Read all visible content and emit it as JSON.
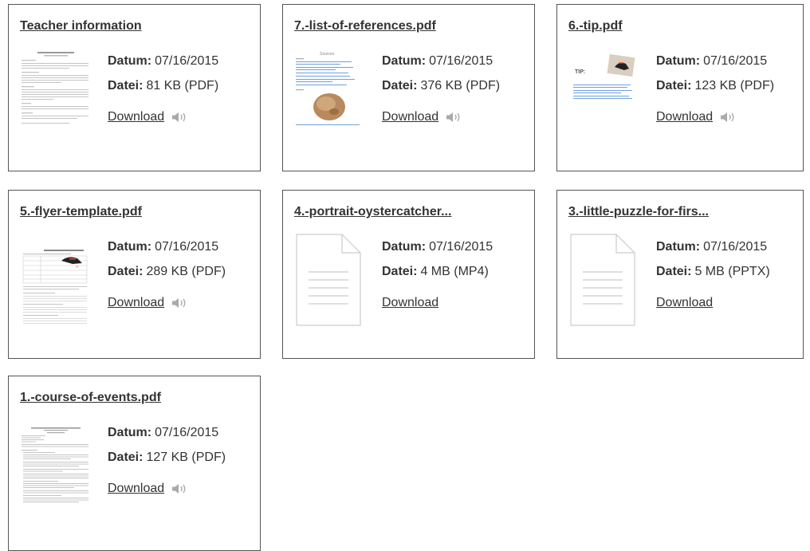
{
  "cards": [
    {
      "title": "Teacher information",
      "date_label": "Datum:",
      "date": "07/16/2015",
      "size_label": "Datei:",
      "size": "81 KB (PDF)",
      "download": "Download"
    },
    {
      "title": "7.-list-of-references.pdf",
      "date_label": "Datum:",
      "date": "07/16/2015",
      "size_label": "Datei:",
      "size": "376 KB (PDF)",
      "download": "Download",
      "thumb_heading": "Sources"
    },
    {
      "title": "6.-tip.pdf",
      "date_label": "Datum:",
      "date": "07/16/2015",
      "size_label": "Datei:",
      "size": "123 KB (PDF)",
      "download": "Download",
      "thumb_heading": "TIP:"
    },
    {
      "title": "5.-flyer-template.pdf",
      "date_label": "Datum:",
      "date": "07/16/2015",
      "size_label": "Datei:",
      "size": "289 KB (PDF)",
      "download": "Download"
    },
    {
      "title": "4.-portrait-oystercatcher...",
      "date_label": "Datum:",
      "date": "07/16/2015",
      "size_label": "Datei:",
      "size": "4 MB (MP4)",
      "download": "Download"
    },
    {
      "title": "3.-little-puzzle-for-firs...",
      "date_label": "Datum:",
      "date": "07/16/2015",
      "size_label": "Datei:",
      "size": "5 MB (PPTX)",
      "download": "Download"
    },
    {
      "title": "1.-course-of-events.pdf",
      "date_label": "Datum:",
      "date": "07/16/2015",
      "size_label": "Datei:",
      "size": "127 KB (PDF)",
      "download": "Download"
    }
  ],
  "colors": {
    "border": "#555555",
    "text": "#333333",
    "thumb_text": "#999999",
    "thumb_link": "#6fa0dc",
    "icon": "#aaaaaa"
  },
  "icons": {
    "speaker": "speaker-icon",
    "generic_file": "document-file-icon"
  }
}
